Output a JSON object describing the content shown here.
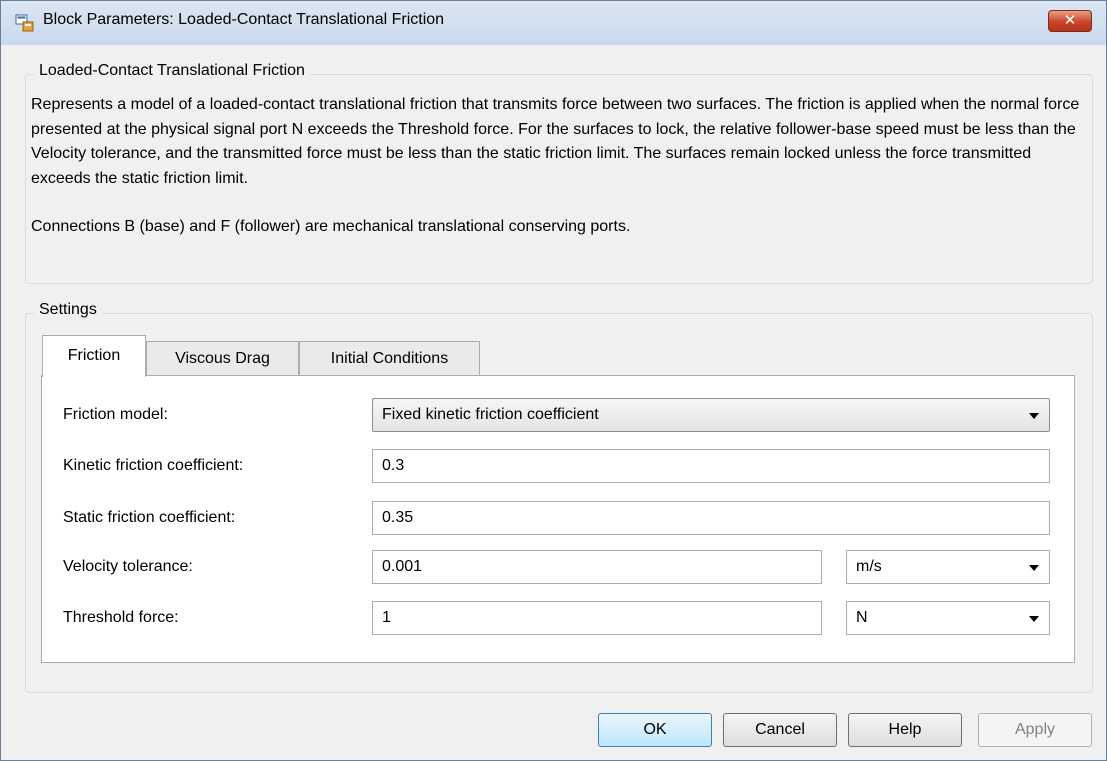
{
  "window": {
    "title": "Block Parameters: Loaded-Contact Translational Friction",
    "close_glyph": "✕",
    "icon": "simulink-block-icon"
  },
  "block": {
    "group_title": "Loaded-Contact Translational Friction",
    "description_1": "Represents a model of a loaded-contact translational friction that transmits force between two surfaces. The friction is applied when the normal force presented at the physical signal port N exceeds the Threshold force. For the surfaces to lock, the relative follower-base speed must be less than the Velocity tolerance, and the transmitted force must be less than the static friction limit. The surfaces remain locked unless the force transmitted exceeds the static friction limit.",
    "description_2": "Connections B (base) and F (follower) are mechanical translational conserving ports."
  },
  "settings": {
    "group_title": "Settings",
    "tabs": [
      {
        "label": "Friction",
        "active": true
      },
      {
        "label": "Viscous Drag",
        "active": false
      },
      {
        "label": "Initial Conditions",
        "active": false
      }
    ],
    "params": {
      "friction_model": {
        "label": "Friction model:",
        "value": "Fixed kinetic friction coefficient"
      },
      "kinetic_coef": {
        "label": "Kinetic friction coefficient:",
        "value": "0.3"
      },
      "static_coef": {
        "label": "Static friction coefficient:",
        "value": "0.35"
      },
      "velocity_tol": {
        "label": "Velocity tolerance:",
        "value": "0.001",
        "unit": "m/s"
      },
      "threshold_force": {
        "label": "Threshold force:",
        "value": "1",
        "unit": "N"
      }
    }
  },
  "buttons": {
    "ok": "OK",
    "cancel": "Cancel",
    "help": "Help",
    "apply": "Apply"
  },
  "colors": {
    "titlebar": "#c9d9ec",
    "close": "#c8452a",
    "window_bg": "#f0f0f0",
    "default_button": "#bee6fd"
  }
}
